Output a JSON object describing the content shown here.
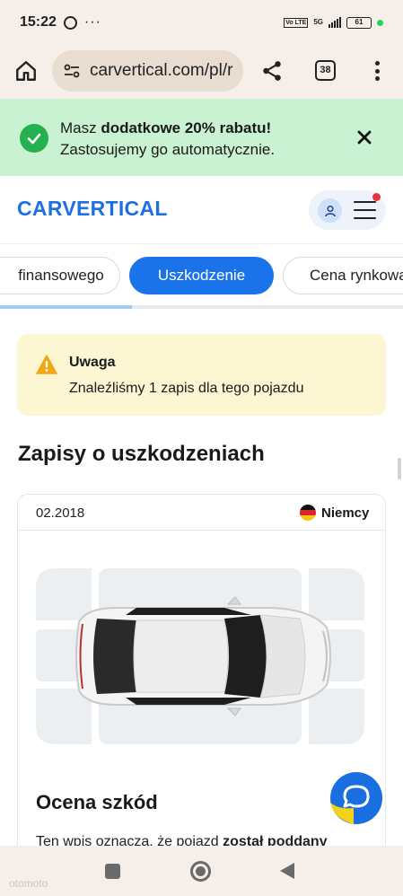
{
  "status_bar": {
    "time": "15:22",
    "menu_dots": "···",
    "lte_tag": "Vo LTE",
    "network": "5G",
    "battery": "61"
  },
  "browser": {
    "url": "carvertical.com/pl/r",
    "tab_count": "38"
  },
  "promo": {
    "line1_prefix": "Masz ",
    "line1_bold": "dodatkowe 20% rabatu!",
    "line2": "Zastosujemy go automatycznie."
  },
  "header": {
    "logo_text": "CARVERTICAL",
    "brand_color": "#1f6fe0"
  },
  "chips": [
    {
      "label": "finansowego",
      "active": false
    },
    {
      "label": "Uszkodzenie",
      "active": true
    },
    {
      "label": "Cena rynkowa",
      "active": false
    }
  ],
  "warning": {
    "title": "Uwaga",
    "text": "Znaleźliśmy 1 zapis dla tego pojazdu"
  },
  "section": {
    "title": "Zapisy o uszkodzeniach"
  },
  "record": {
    "date": "02.2018",
    "country": "Niemcy",
    "assessment_title": "Ocena szkód",
    "text_prefix": "Ten wpis oznacza, że pojazd ",
    "text_bold": "został poddany"
  },
  "watermark": "otomoto"
}
